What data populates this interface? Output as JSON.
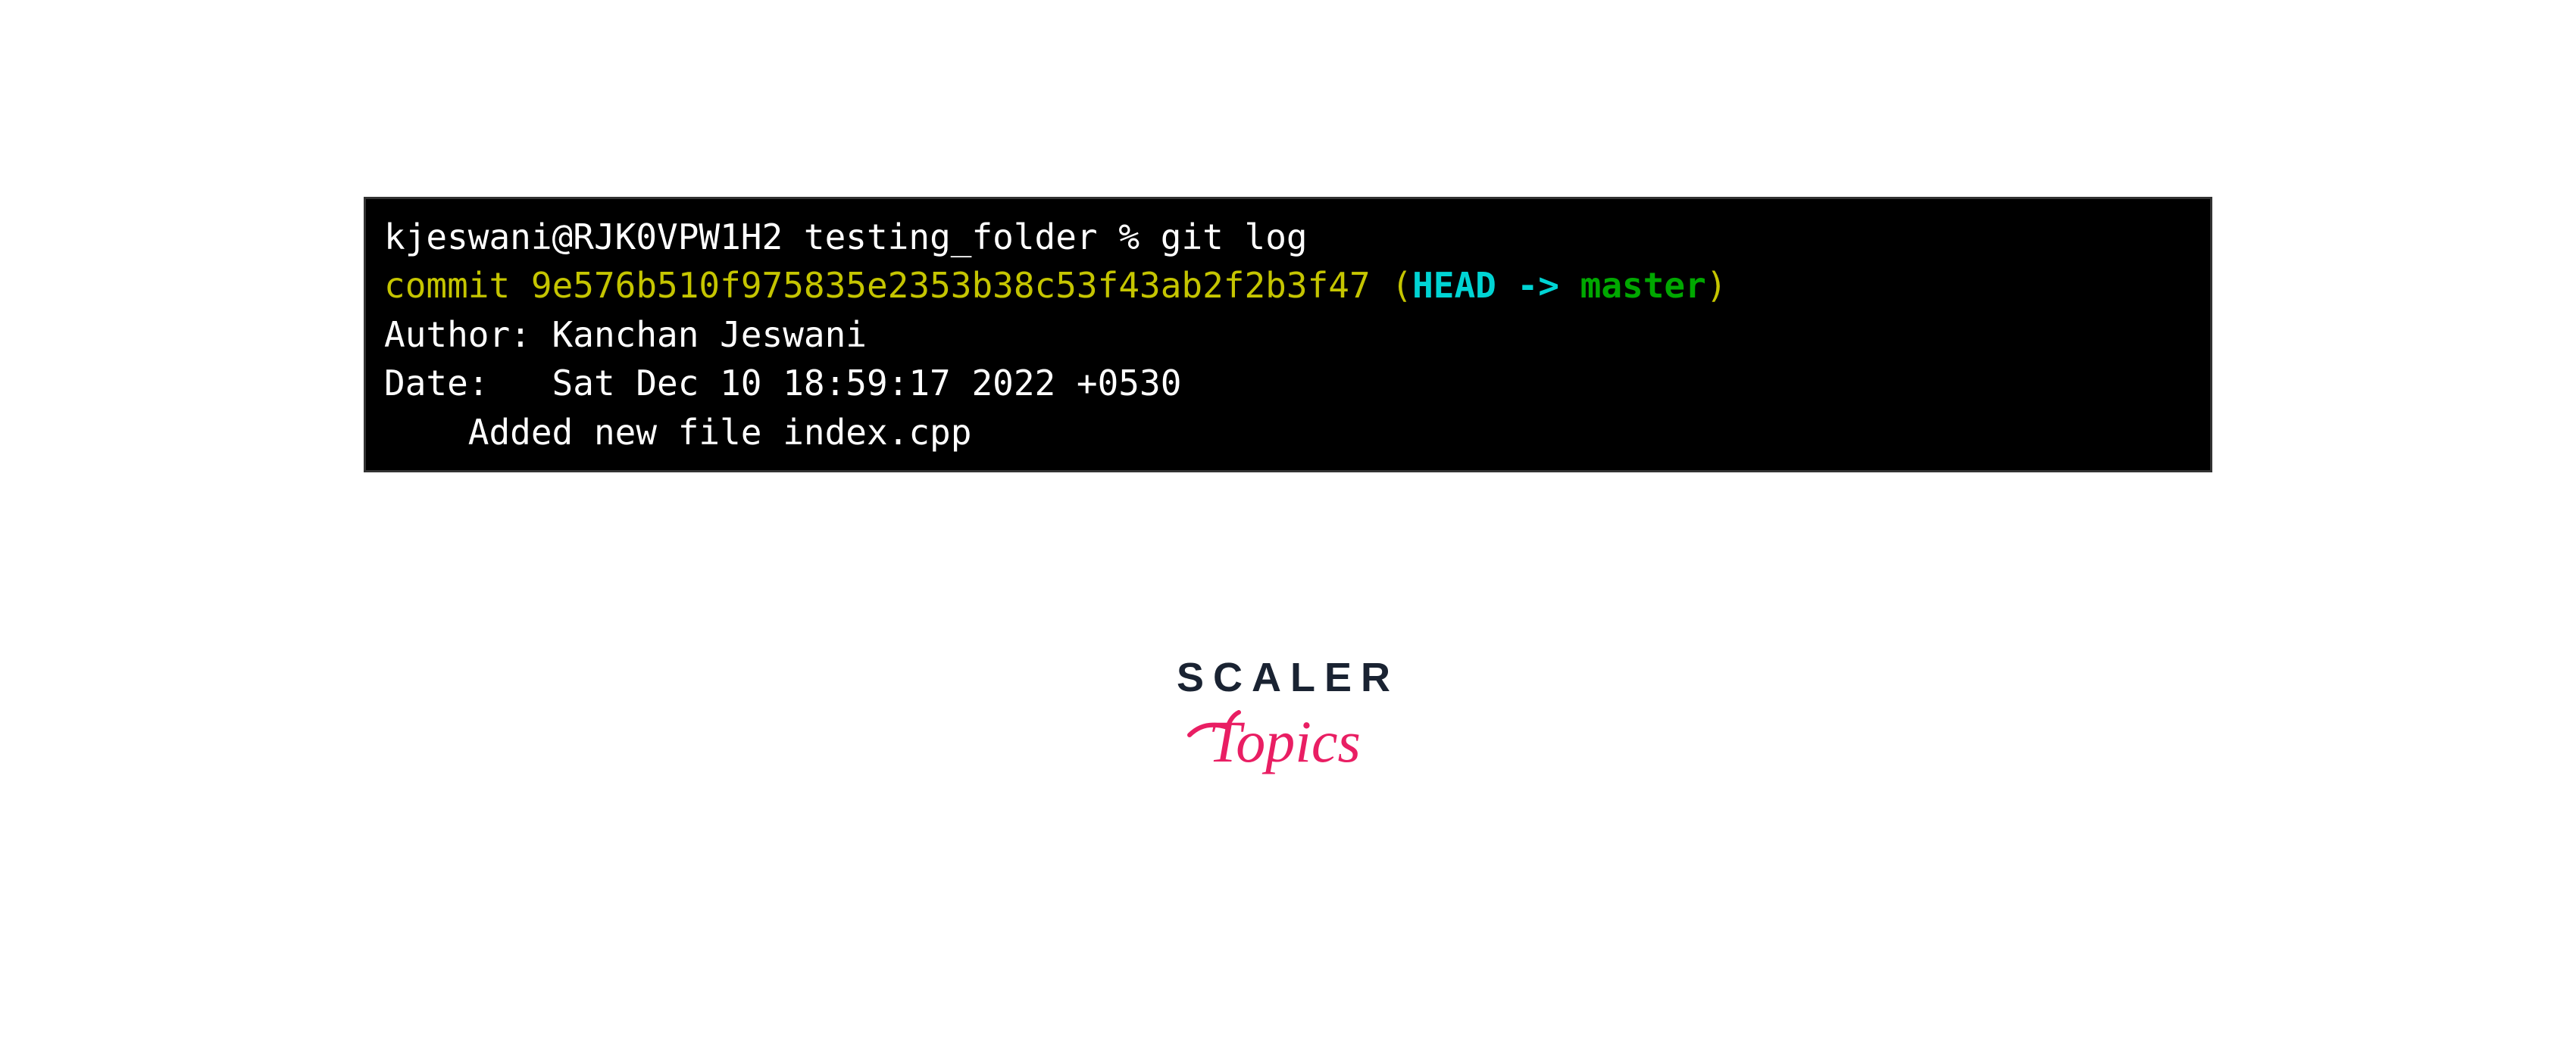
{
  "terminal": {
    "prompt": {
      "user_host": "kjeswani@RJK0VPW1H2",
      "directory": "testing_folder",
      "symbol": "%",
      "command": "git log"
    },
    "commit_line": {
      "label": "commit",
      "hash": "9e576b510f975835e2353b38c53f43ab2f2b3f47",
      "paren_open": "(",
      "head": "HEAD -> ",
      "branch": "master",
      "paren_close": ")"
    },
    "author_line": "Author: Kanchan Jeswani",
    "date_line": "Date:   Sat Dec 10 18:59:17 2022 +0530",
    "blank_line": "",
    "message_line": "    Added new file index.cpp"
  },
  "logo": {
    "line1": "SCALER",
    "line2": "Topics"
  }
}
